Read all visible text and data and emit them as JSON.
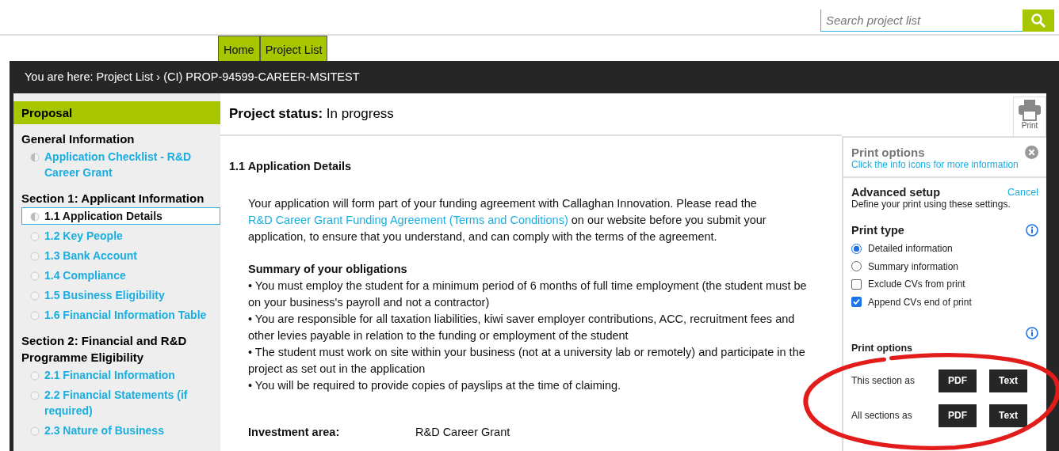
{
  "search": {
    "placeholder": "Search project list"
  },
  "nav_tabs": [
    {
      "label": "Home"
    },
    {
      "label": "Project List"
    }
  ],
  "breadcrumb": "You are here: Project List › (CI) PROP-94599-CAREER-MSITEST",
  "sidebar": {
    "title": "Proposal",
    "groups": [
      {
        "heading": "General Information",
        "items": [
          {
            "label": "Application Checklist - R&D Career Grant",
            "started": true,
            "selected": false
          }
        ]
      },
      {
        "heading": "Section 1: Applicant Information",
        "items": [
          {
            "label": "1.1 Application Details",
            "started": true,
            "selected": true
          },
          {
            "label": "1.2 Key People",
            "started": false,
            "selected": false
          },
          {
            "label": "1.3 Bank Account",
            "started": false,
            "selected": false
          },
          {
            "label": "1.4 Compliance",
            "started": false,
            "selected": false
          },
          {
            "label": "1.5 Business Eligibility",
            "started": false,
            "selected": false
          },
          {
            "label": "1.6 Financial Information Table",
            "started": false,
            "selected": false
          }
        ]
      },
      {
        "heading": "Section 2: Financial and R&D Programme Eligibility",
        "items": [
          {
            "label": "2.1 Financial Information",
            "started": false,
            "selected": false
          },
          {
            "label": "2.2 Financial Statements (if required)",
            "started": false,
            "selected": false
          },
          {
            "label": "2.3 Nature of Business",
            "started": false,
            "selected": false
          }
        ]
      }
    ]
  },
  "status": {
    "label": "Project status:",
    "value": "In progress"
  },
  "print_button": {
    "label": "Print"
  },
  "content": {
    "heading": "1.1 Application Details",
    "intro_before": "Your application will form part of your funding agreement with Callaghan Innovation. Please read the",
    "intro_link": "R&D Career Grant Funding Agreement (Terms and Conditions)",
    "intro_after": "on our website before you submit your application, to ensure that you understand, and can comply with the terms of the agreement.",
    "summary_title": "Summary of your obligations",
    "bullets": [
      "• You must employ the student for a minimum period of 6 months of full time employment (the student must be on your business's payroll and not a contractor)",
      "• You are responsible for all taxation liabilities, kiwi saver employer contributions, ACC, recruitment fees and other levies payable in relation to the funding or employment of the student",
      "• The student must work on site within your business (not at a university lab or remotely) and participate in the project as set out in the application",
      "• You will be required to provide copies of payslips at the time of claiming."
    ],
    "details": [
      {
        "label": "Investment area:",
        "value": "R&D Career Grant"
      }
    ]
  },
  "print_panel": {
    "title": "Print options",
    "hint": "Click the info icons for more information",
    "setup_title": "Advanced setup",
    "cancel": "Cancel",
    "setup_description": "Define your print using these settings.",
    "type_title": "Print type",
    "options": [
      {
        "kind": "radio",
        "label": "Detailed information",
        "checked": true
      },
      {
        "kind": "radio",
        "label": "Summary information",
        "checked": false
      },
      {
        "kind": "checkbox",
        "label": "Exclude CVs from print",
        "checked": false
      },
      {
        "kind": "checkbox",
        "label": "Append CVs end of print",
        "checked": true
      }
    ],
    "export_title": "Print options",
    "exports": [
      {
        "label": "This section as",
        "buttons": [
          "PDF",
          "Text"
        ]
      },
      {
        "label": "All sections as",
        "buttons": [
          "PDF",
          "Text"
        ]
      }
    ]
  },
  "annotations": [
    {
      "kind": "ellipse"
    }
  ]
}
